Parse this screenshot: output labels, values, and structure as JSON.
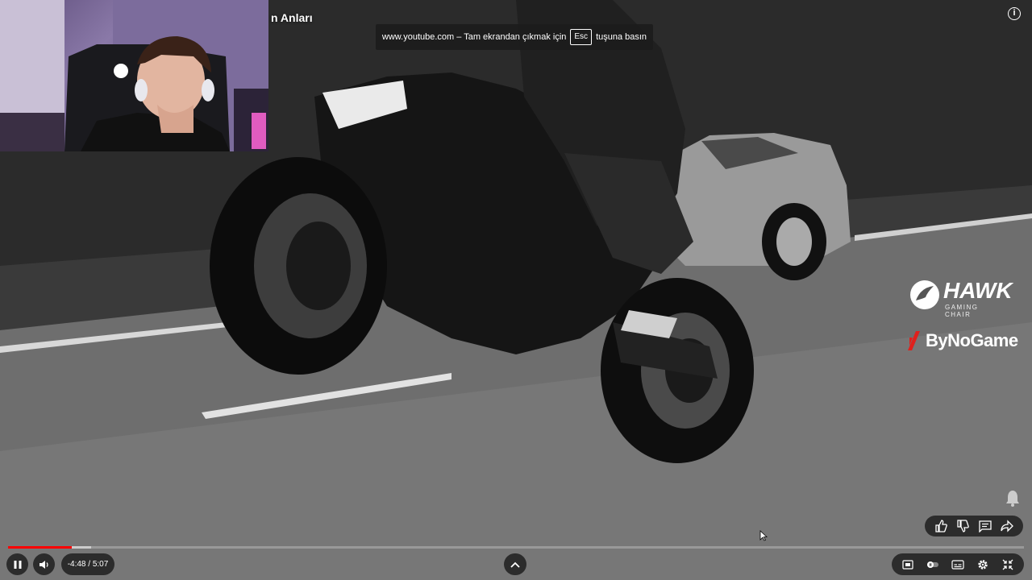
{
  "video": {
    "title": "n Anları",
    "scene": "grayscale-motorcycle-wheelie"
  },
  "fullscreen_notice": {
    "before": "www.youtube.com – Tam ekrandan çıkmak için",
    "key": "Esc",
    "after": "tuşuna basın"
  },
  "info_icon": "i",
  "sponsors": {
    "hawk_name": "HAWK",
    "hawk_sub": "GAMING CHAIR",
    "bynogame": "ByNoGame"
  },
  "player": {
    "time_display": "-4:48 / 5:07",
    "progress_played": 0.063,
    "progress_loaded": 0.082,
    "accent_color": "#ff0000"
  },
  "icons": {
    "play_pause": "pause-icon",
    "volume": "volume-icon",
    "chapters": "chevron-up-icon",
    "like": "thumbs-up-icon",
    "dislike": "thumbs-down-icon",
    "comments": "comment-icon",
    "share": "share-icon",
    "bell": "bell-icon",
    "quality": "quality-icon",
    "autoplay": "autoplay-toggle-icon",
    "subtitles": "subtitles-icon",
    "settings": "gear-icon",
    "exit_fullscreen": "exit-fullscreen-icon"
  }
}
